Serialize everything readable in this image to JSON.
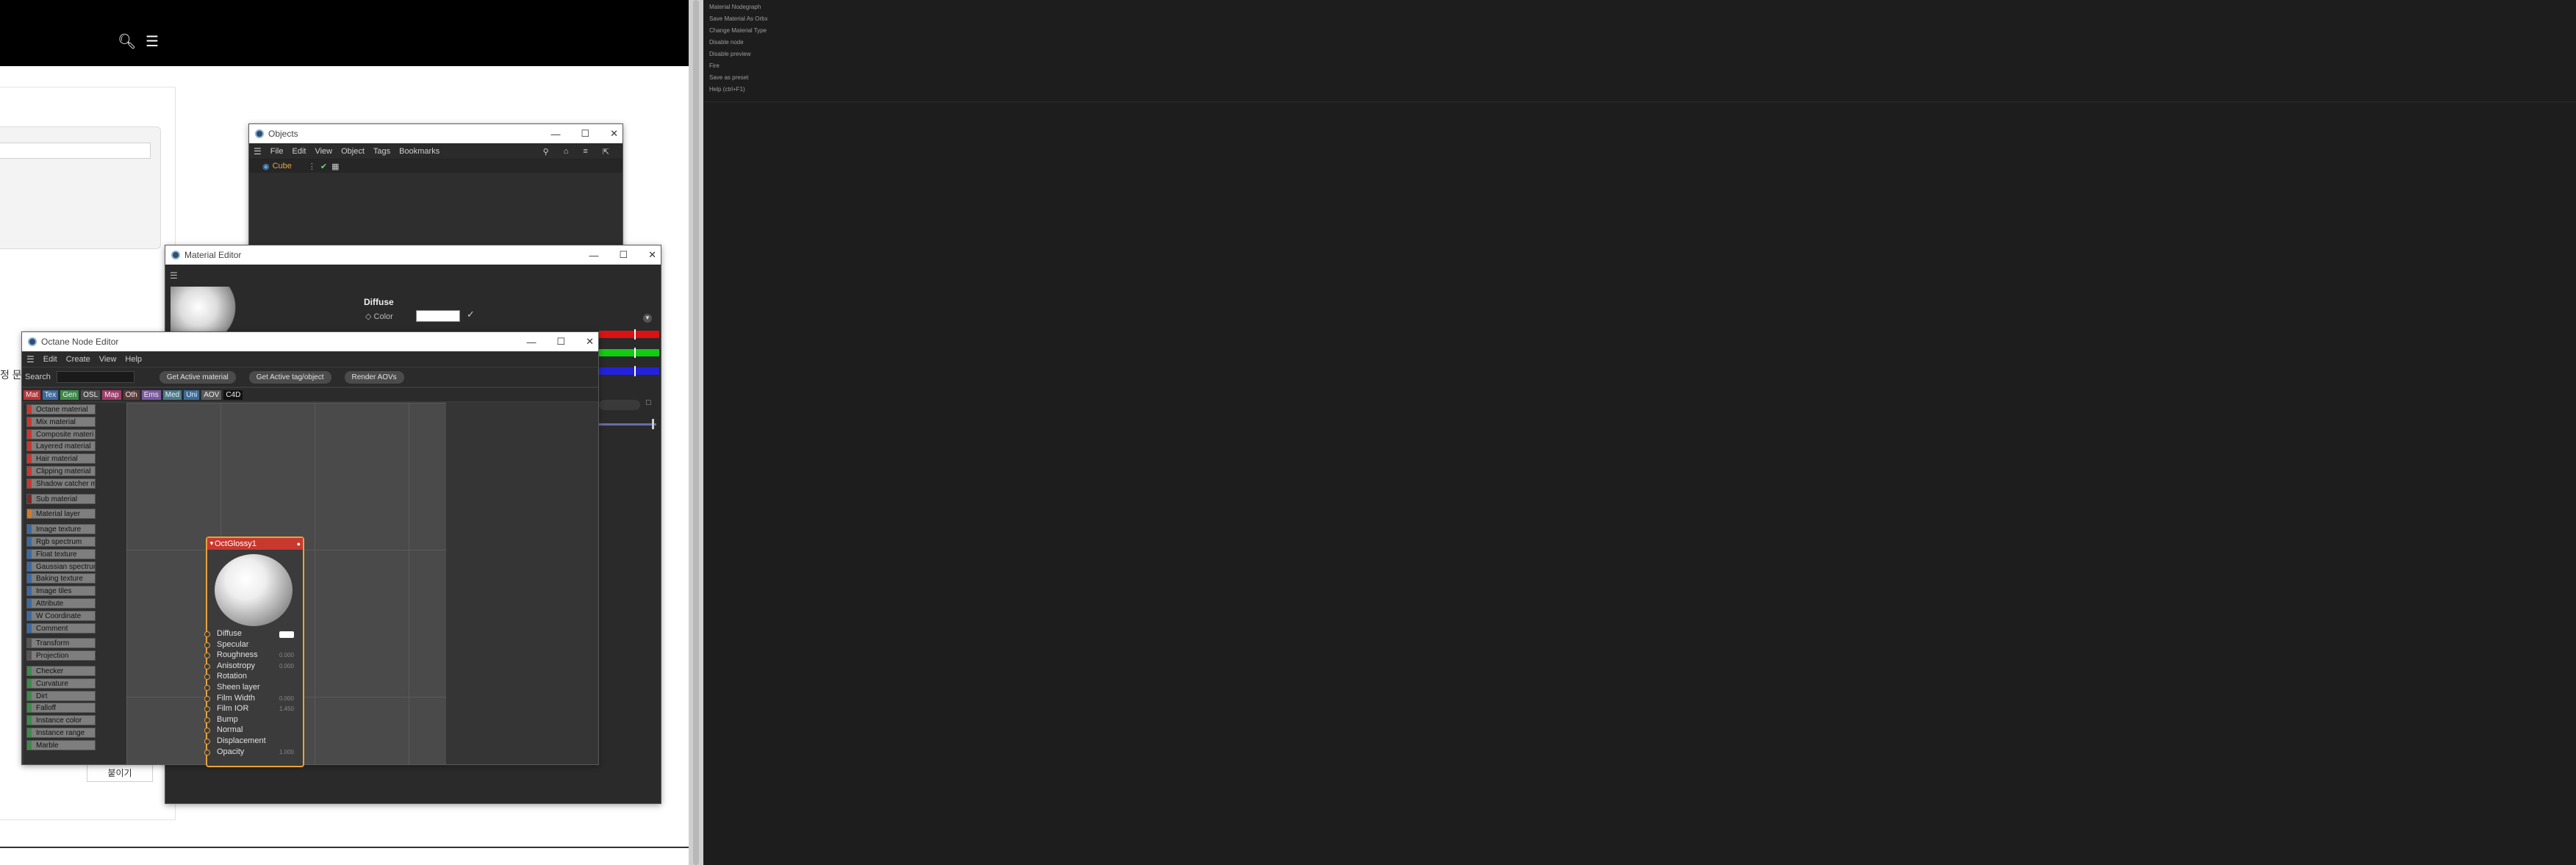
{
  "browser": {
    "bg_partial_text": "정 문",
    "bg_button": "붙이기"
  },
  "context_menu": {
    "items": [
      "Material Nodegraph",
      "Save Material As Orbx",
      "Change Material Type",
      "Disable node",
      "Disable preview",
      "Fire",
      "Save as preset",
      "Help (ctrl+F1)"
    ]
  },
  "objects_window": {
    "title": "Objects",
    "menu": [
      "File",
      "Edit",
      "View",
      "Object",
      "Tags",
      "Bookmarks"
    ],
    "object_name": "Cube"
  },
  "material_editor": {
    "title": "Material Editor",
    "section": "Diffuse",
    "color_label": "Color"
  },
  "octane": {
    "title": "Octane Node Editor",
    "menu": [
      "Edit",
      "Create",
      "View",
      "Help"
    ],
    "search_label": "Search",
    "buttons": [
      "Get Active material",
      "Get Active tag/object",
      "Render AOVs"
    ],
    "tabs": [
      {
        "label": "Mat",
        "color": "#b7363a"
      },
      {
        "label": "Tex",
        "color": "#3c6aa0"
      },
      {
        "label": "Gen",
        "color": "#3d8a4a"
      },
      {
        "label": "OSL",
        "color": "#4a4a4a"
      },
      {
        "label": "Map",
        "color": "#a03c6a"
      },
      {
        "label": "Oth",
        "color": "#5a3a3a"
      },
      {
        "label": "Ems",
        "color": "#7a5aa0"
      },
      {
        "label": "Med",
        "color": "#4a7a8a"
      },
      {
        "label": "Uni",
        "color": "#3a6a9a"
      },
      {
        "label": "AOV",
        "color": "#5a5a5a"
      },
      {
        "label": "C4D",
        "color": "#111111"
      }
    ],
    "node_list": [
      {
        "label": "Octane material",
        "color": "#c8382f"
      },
      {
        "label": "Mix material",
        "color": "#c8382f"
      },
      {
        "label": "Composite materi",
        "color": "#c8382f"
      },
      {
        "label": "Layered material",
        "color": "#c8382f"
      },
      {
        "label": "Hair material",
        "color": "#c8382f"
      },
      {
        "label": "Clipping material",
        "color": "#c8382f"
      },
      {
        "label": "Shadow catcher m",
        "color": "#c8382f"
      },
      {
        "label": "Sub material",
        "color": "#7a2a2a"
      },
      {
        "label": "Material layer",
        "color": "#d07a2a"
      },
      {
        "label": "Image texture",
        "color": "#3c6aa0"
      },
      {
        "label": "Rgb spectrum",
        "color": "#3c6aa0"
      },
      {
        "label": "Float texture",
        "color": "#3c6aa0"
      },
      {
        "label": "Gaussian spectrur",
        "color": "#3c6aa0"
      },
      {
        "label": "Baking texture",
        "color": "#3c6aa0"
      },
      {
        "label": "Image tiles",
        "color": "#3c6aa0"
      },
      {
        "label": "Attribute",
        "color": "#3c6aa0"
      },
      {
        "label": "W Coordinate",
        "color": "#3c6aa0"
      },
      {
        "label": "Comment",
        "color": "#3c6aa0"
      },
      {
        "label": "Transform",
        "color": "#555555"
      },
      {
        "label": "Projection",
        "color": "#555555"
      },
      {
        "label": "Checker",
        "color": "#3d8a4a"
      },
      {
        "label": "Curvature",
        "color": "#3d8a4a"
      },
      {
        "label": "Dirt",
        "color": "#3d8a4a"
      },
      {
        "label": "Falloff",
        "color": "#3d8a4a"
      },
      {
        "label": "Instance color",
        "color": "#3d8a4a"
      },
      {
        "label": "Instance range",
        "color": "#3d8a4a"
      },
      {
        "label": "Marble",
        "color": "#3d8a4a"
      }
    ],
    "node": {
      "title": "OctGlossy1",
      "pins": [
        {
          "label": "Diffuse",
          "value": ""
        },
        {
          "label": "Specular",
          "value": ""
        },
        {
          "label": "Roughness",
          "value": "0.000"
        },
        {
          "label": "Anisotropy",
          "value": "0.000"
        },
        {
          "label": "Rotation",
          "value": ""
        },
        {
          "label": "Sheen layer",
          "value": ""
        },
        {
          "label": "Film Width",
          "value": "0.000"
        },
        {
          "label": "Film IOR",
          "value": "1.450"
        },
        {
          "label": "Bump",
          "value": ""
        },
        {
          "label": "Normal",
          "value": ""
        },
        {
          "label": "Displacement",
          "value": ""
        },
        {
          "label": "Opacity",
          "value": "1.000"
        }
      ]
    }
  }
}
